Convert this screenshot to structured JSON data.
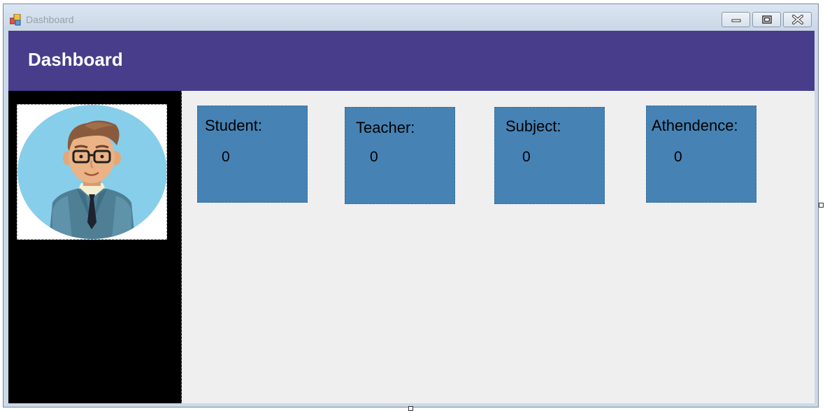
{
  "window": {
    "title": "Dashboard",
    "controls": [
      "minimize",
      "maximize",
      "close"
    ]
  },
  "header": {
    "title": "Dashboard",
    "color": "#483d8b"
  },
  "sidebar": {
    "color": "#000000",
    "avatar": "user-avatar-illustration"
  },
  "cards": [
    {
      "label": "Student:",
      "count": "0"
    },
    {
      "label": "Teacher:",
      "count": "0"
    },
    {
      "label": "Subject:",
      "count": "0"
    },
    {
      "label": "Athendence:",
      "count": "0"
    }
  ],
  "colors": {
    "card": "#4682b4",
    "content_bg": "#efefef"
  }
}
